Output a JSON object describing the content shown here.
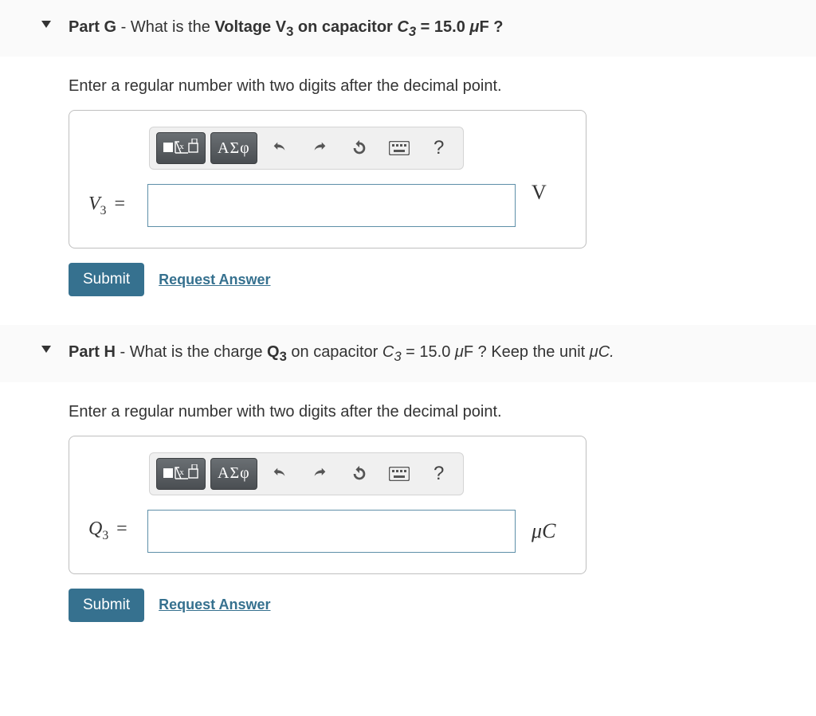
{
  "parts": [
    {
      "part_label": "Part G",
      "sep": " - ",
      "question_prefix": "What is the ",
      "question_bold_1": "Voltage V",
      "question_bold_sub": "3",
      "question_bold_2": " on capacitor ",
      "question_cap": "C",
      "question_cap_sub": "3",
      "question_eq": " = 15.0 ",
      "question_unit_mu": "μ",
      "question_unit_rest": "F ?",
      "question_tail": "",
      "instructions": "Enter a regular number with two digits after the decimal point.",
      "var_symbol": "V",
      "var_sub": "3",
      "equals": " =",
      "unit_display": "V",
      "submit_label": "Submit",
      "request_label": "Request Answer",
      "input_value": ""
    },
    {
      "part_label": "Part H",
      "sep": " - ",
      "question_prefix": "What is the charge ",
      "question_bold_1": "Q",
      "question_bold_sub": "3",
      "question_bold_2": " on capacitor ",
      "question_cap": "C",
      "question_cap_sub": "3",
      "question_eq": " = 15.0 ",
      "question_unit_mu": "μ",
      "question_unit_rest": "F ? Keep the unit ",
      "question_tail_mu": "μ",
      "question_tail_rest": "C.",
      "instructions": "Enter a regular number with two digits after the decimal point.",
      "var_symbol": "Q",
      "var_sub": "3",
      "equals": " =",
      "unit_display_mu": "μ",
      "unit_display_rest": "C",
      "submit_label": "Submit",
      "request_label": "Request Answer",
      "input_value": ""
    }
  ],
  "toolbar": {
    "greek_label": "ΑΣφ",
    "help_label": "?"
  }
}
